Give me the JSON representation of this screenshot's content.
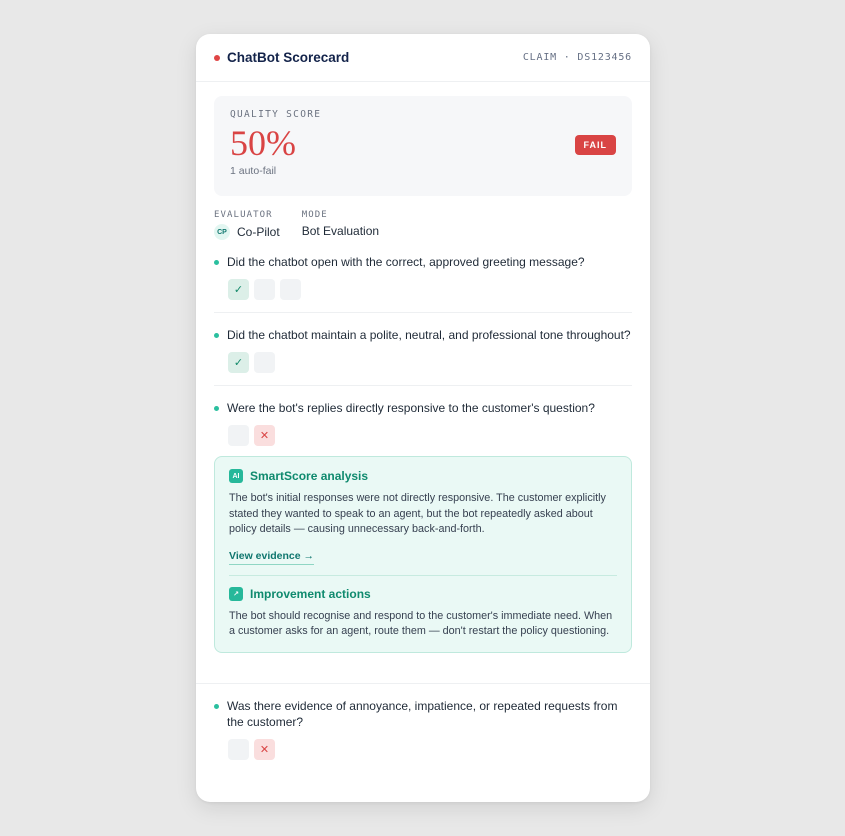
{
  "header": {
    "title": "ChatBot Scorecard",
    "claim": "CLAIM · DS123456",
    "accent": "#e04545"
  },
  "score": {
    "label": "QUALITY SCORE",
    "value": "50%",
    "sub": "1 auto-fail",
    "badge": "FAIL",
    "color": "#d94444"
  },
  "meta": {
    "evaluator_label": "EVALUATOR",
    "evaluator_initials": "CP",
    "evaluator_name": "Co-Pilot",
    "mode_label": "MODE",
    "mode_value": "Bot Evaluation"
  },
  "questions": [
    {
      "text": "Did the chatbot open with the correct, approved greeting message?",
      "answers": [
        "yes",
        "empty",
        "empty"
      ]
    },
    {
      "text": "Did the chatbot maintain a polite, neutral, and professional tone throughout?",
      "answers": [
        "yes",
        "empty"
      ]
    },
    {
      "text": "Were the bot's replies directly responsive to the customer's question?",
      "answers": [
        "empty",
        "no"
      ]
    },
    {
      "text": "Was there evidence of annoyance, impatience, or repeated requests from the customer?",
      "answers": [
        "empty",
        "no"
      ]
    }
  ],
  "answer_glyphs": {
    "yes": "✓",
    "no": "✕",
    "empty": ""
  },
  "analysis": {
    "icon_label": "AI",
    "title": "SmartScore analysis",
    "text": "The bot's initial responses were not directly responsive. The customer explicitly stated they wanted to speak to an agent, but the bot repeatedly asked about policy details — causing unnecessary back-and-forth.",
    "link": "View evidence →",
    "improvement_icon": "↗",
    "improvement_title": "Improvement actions",
    "improvement_text": "The bot should recognise and respond to the customer's immediate need. When a customer asks for an agent, route them — don't restart the policy questioning."
  }
}
